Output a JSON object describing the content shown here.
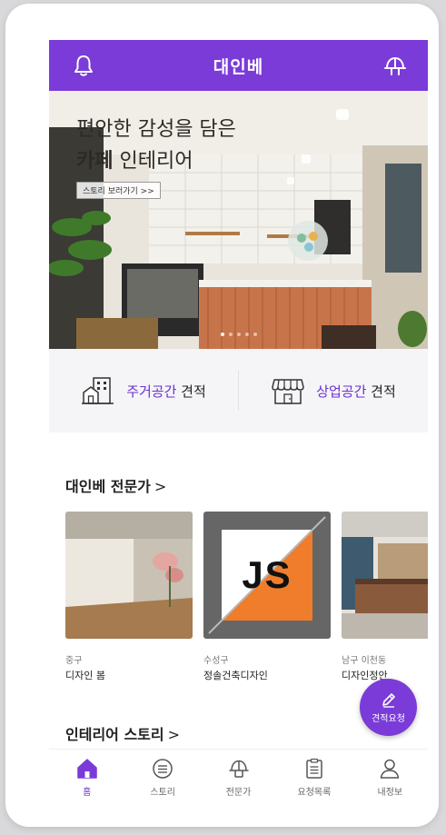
{
  "app": {
    "title": "대인베"
  },
  "header": {
    "left_icon": "bell-icon",
    "right_icon": "helmet-icon"
  },
  "banner": {
    "line1": "편안한 감성을 담은",
    "line2_bold": "카페",
    "line2_rest": " 인테리어",
    "cta": "스토리 보러가기 >>",
    "dots_total": 5,
    "dots_active": 1
  },
  "quotes": {
    "residential": {
      "accent": "주거공간",
      "rest": " 견적"
    },
    "commercial": {
      "accent": "상업공간",
      "rest": " 견적"
    }
  },
  "experts_section": {
    "title": "대인베 전문가",
    "chevron": ">",
    "items": [
      {
        "area": "중구",
        "name": "디자인 봄"
      },
      {
        "area": "수성구",
        "name": "정솔건축디자인",
        "logo_text": "JS"
      },
      {
        "area": "남구 이천동",
        "name": "디자인정안"
      }
    ]
  },
  "story_section": {
    "title": "인테리어 스토리",
    "chevron": ">"
  },
  "fab": {
    "label": "견적요청"
  },
  "nav": {
    "items": [
      {
        "label": "홈",
        "icon": "home-icon"
      },
      {
        "label": "스토리",
        "icon": "list-circle-icon"
      },
      {
        "label": "전문가",
        "icon": "helmet-icon"
      },
      {
        "label": "요청목록",
        "icon": "clipboard-icon"
      },
      {
        "label": "내정보",
        "icon": "person-icon"
      }
    ]
  },
  "colors": {
    "accent": "#7a3bd8",
    "accent_text": "#6b2fd0",
    "js_orange": "#ef7d2c"
  }
}
